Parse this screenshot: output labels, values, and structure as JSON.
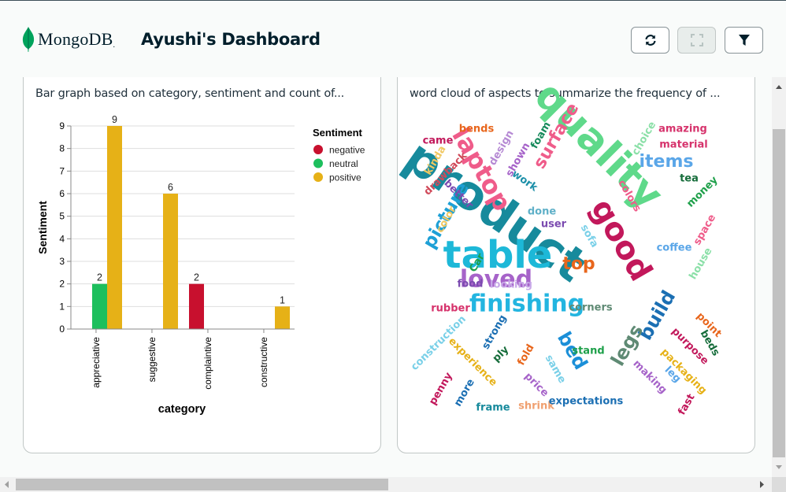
{
  "header": {
    "logo_text": "MongoDB",
    "logo_dot": ".",
    "title": "Ayushi's Dashboard",
    "buttons": [
      {
        "name": "refresh",
        "icon": "refresh-icon"
      },
      {
        "name": "fullscreen",
        "icon": "expand-icon",
        "disabled": true
      },
      {
        "name": "filter",
        "icon": "filter-icon"
      }
    ]
  },
  "cards": [
    {
      "subtitle": "Bar graph based on category, sentiment and count of..."
    },
    {
      "subtitle": "word cloud of aspects to summarize the frequency of ..."
    }
  ],
  "chart_data": {
    "type": "bar",
    "categories": [
      "appreciative",
      "suggestive",
      "complaintive",
      "constructive"
    ],
    "series": [
      {
        "name": "negative",
        "color": "#c8102e",
        "values": [
          null,
          null,
          2,
          null
        ]
      },
      {
        "name": "neutral",
        "color": "#1dbf5d",
        "values": [
          2,
          null,
          null,
          null
        ]
      },
      {
        "name": "positive",
        "color": "#e6b117",
        "values": [
          9,
          6,
          null,
          1
        ]
      }
    ],
    "xlabel": "category",
    "ylabel": "Sentiment",
    "ylim": [
      0,
      9
    ],
    "yticks": [
      "0",
      "1",
      "2",
      "3",
      "4",
      "5",
      "6",
      "7",
      "8",
      "9"
    ],
    "legend_title": "Sentiment",
    "legend_position": "right",
    "grid": true
  },
  "word_cloud": [
    {
      "text": "product",
      "color": "#178a9c",
      "size": 60
    },
    {
      "text": "quality",
      "color": "#5fd98a",
      "size": 52
    },
    {
      "text": "table",
      "color": "#1db8d8",
      "size": 48
    },
    {
      "text": "good",
      "color": "#c2185b",
      "size": 40
    },
    {
      "text": "laptop",
      "color": "#ef5c8a",
      "size": 32
    },
    {
      "text": "loved",
      "color": "#a663c9",
      "size": 30
    },
    {
      "text": "finishing",
      "color": "#23b5e0",
      "size": 30
    },
    {
      "text": "picture",
      "color": "#1ea0d6",
      "size": 23
    },
    {
      "text": "surface",
      "color": "#ef5c8a",
      "size": 22
    },
    {
      "text": "items",
      "color": "#5aa6e8",
      "size": 22
    },
    {
      "text": "build",
      "color": "#1b6fb3",
      "size": 24
    },
    {
      "text": "legs",
      "color": "#5f8a74",
      "size": 24
    },
    {
      "text": "bed",
      "color": "#1b8fd8",
      "size": 24
    },
    {
      "text": "top",
      "color": "#e8661c",
      "size": 22
    },
    {
      "text": "bends",
      "color": "#e8661c",
      "size": 13
    },
    {
      "text": "amazing",
      "color": "#d6336c",
      "size": 13
    },
    {
      "text": "came",
      "color": "#c2185b",
      "size": 13
    },
    {
      "text": "design",
      "color": "#b68ad4",
      "size": 13
    },
    {
      "text": "foam",
      "color": "#178a5c",
      "size": 13
    },
    {
      "text": "choice",
      "color": "#8be0a8",
      "size": 13
    },
    {
      "text": "material",
      "color": "#d6336c",
      "size": 13
    },
    {
      "text": "kinda",
      "color": "#f0c862",
      "size": 13
    },
    {
      "text": "drawback",
      "color": "#d04a5a",
      "size": 13
    },
    {
      "text": "shown",
      "color": "#a663c9",
      "size": 13
    },
    {
      "text": "tea",
      "color": "#156c3a",
      "size": 13
    },
    {
      "text": "money",
      "color": "#1ea04a",
      "size": 13
    },
    {
      "text": "work",
      "color": "#1b8fa8",
      "size": 13
    },
    {
      "text": "better",
      "color": "#7b4bb0",
      "size": 13
    },
    {
      "text": "colors",
      "color": "#ef5c8a",
      "size": 13
    },
    {
      "text": "done",
      "color": "#5fb0c8",
      "size": 13
    },
    {
      "text": "user",
      "color": "#7b4bb0",
      "size": 13
    },
    {
      "text": "space",
      "color": "#ef5c8a",
      "size": 13
    },
    {
      "text": "color",
      "color": "#f0c862",
      "size": 13
    },
    {
      "text": "sofa",
      "color": "#7ad0e8",
      "size": 13
    },
    {
      "text": "coffee",
      "color": "#5aa6e8",
      "size": 13
    },
    {
      "text": "Car",
      "color": "#1ea04a",
      "size": 13
    },
    {
      "text": "house",
      "color": "#8be0a8",
      "size": 13
    },
    {
      "text": "food",
      "color": "#7b4bb0",
      "size": 13
    },
    {
      "text": "looking",
      "color": "#c8a8e8",
      "size": 13
    },
    {
      "text": "rubber",
      "color": "#d6336c",
      "size": 13
    },
    {
      "text": "corners",
      "color": "#5f8a74",
      "size": 13
    },
    {
      "text": "point",
      "color": "#e8661c",
      "size": 13
    },
    {
      "text": "construction",
      "color": "#7ad0e8",
      "size": 13
    },
    {
      "text": "strong",
      "color": "#1b6fb3",
      "size": 13
    },
    {
      "text": "beds",
      "color": "#156c3a",
      "size": 13
    },
    {
      "text": "purpose",
      "color": "#c2185b",
      "size": 13
    },
    {
      "text": "ply",
      "color": "#156c3a",
      "size": 13
    },
    {
      "text": "fold",
      "color": "#e8661c",
      "size": 13
    },
    {
      "text": "stand",
      "color": "#1ea04a",
      "size": 13
    },
    {
      "text": "packaging",
      "color": "#e6b117",
      "size": 13
    },
    {
      "text": "experience",
      "color": "#e6b117",
      "size": 13
    },
    {
      "text": "same",
      "color": "#7ad0e8",
      "size": 13
    },
    {
      "text": "leg",
      "color": "#5aa6e8",
      "size": 13
    },
    {
      "text": "making",
      "color": "#a663c9",
      "size": 13
    },
    {
      "text": "price",
      "color": "#a663c9",
      "size": 13
    },
    {
      "text": "penny",
      "color": "#c2185b",
      "size": 13
    },
    {
      "text": "more",
      "color": "#1b6fb3",
      "size": 13
    },
    {
      "text": "fast",
      "color": "#c2185b",
      "size": 13
    },
    {
      "text": "frame",
      "color": "#178a9c",
      "size": 13
    },
    {
      "text": "shrink",
      "color": "#f0a070",
      "size": 13
    },
    {
      "text": "expectations",
      "color": "#1b6fb3",
      "size": 13
    }
  ]
}
